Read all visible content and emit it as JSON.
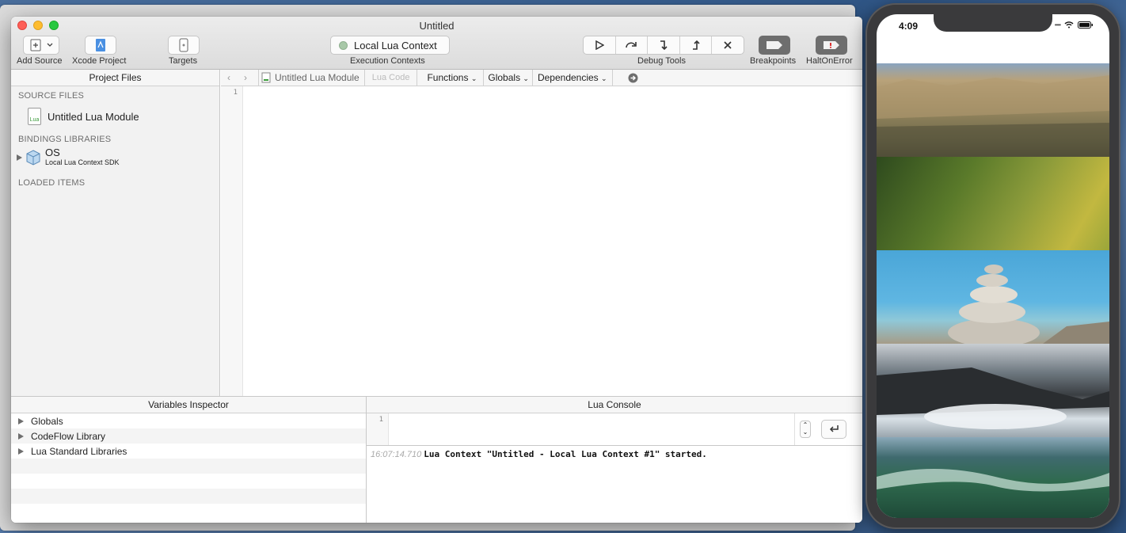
{
  "window": {
    "title": "Untitled"
  },
  "toolbar": {
    "add_source": "Add Source",
    "xcode_project": "Xcode Project",
    "targets": "Targets",
    "execution_context_value": "Local Lua Context",
    "execution_contexts": "Execution Contexts",
    "debug_tools": "Debug Tools",
    "breakpoints": "Breakpoints",
    "halt_on_error": "HaltOnError"
  },
  "sidebar": {
    "header": "Project Files",
    "source_files_title": "SOURCE FILES",
    "source_files": [
      {
        "name": "Untitled Lua Module",
        "icon_label": "Lua"
      }
    ],
    "bindings_title": "BINDINGS LIBRARIES",
    "bindings": [
      {
        "name": "OS",
        "subtitle": "Local Lua Context SDK"
      }
    ],
    "loaded_title": "LOADED ITEMS"
  },
  "editor_bar": {
    "module": "Untitled Lua Module",
    "lua_code": "Lua Code",
    "functions": "Functions",
    "globals": "Globals",
    "dependencies": "Dependencies"
  },
  "editor": {
    "line_number": "1"
  },
  "variables": {
    "header": "Variables Inspector",
    "rows": [
      "Globals",
      "CodeFlow Library",
      "Lua Standard Libraries"
    ]
  },
  "console": {
    "header": "Lua Console",
    "input_line": "1",
    "log_time": "16:07:14.710",
    "log_message": "Lua Context \"Untitled - Local Lua Context #1\" started."
  },
  "phone": {
    "time": "4:09"
  },
  "colors": {
    "accent_grey": "#6e6e6e",
    "red": "#fe5f57",
    "yellow": "#febc2e",
    "green": "#28c840"
  }
}
